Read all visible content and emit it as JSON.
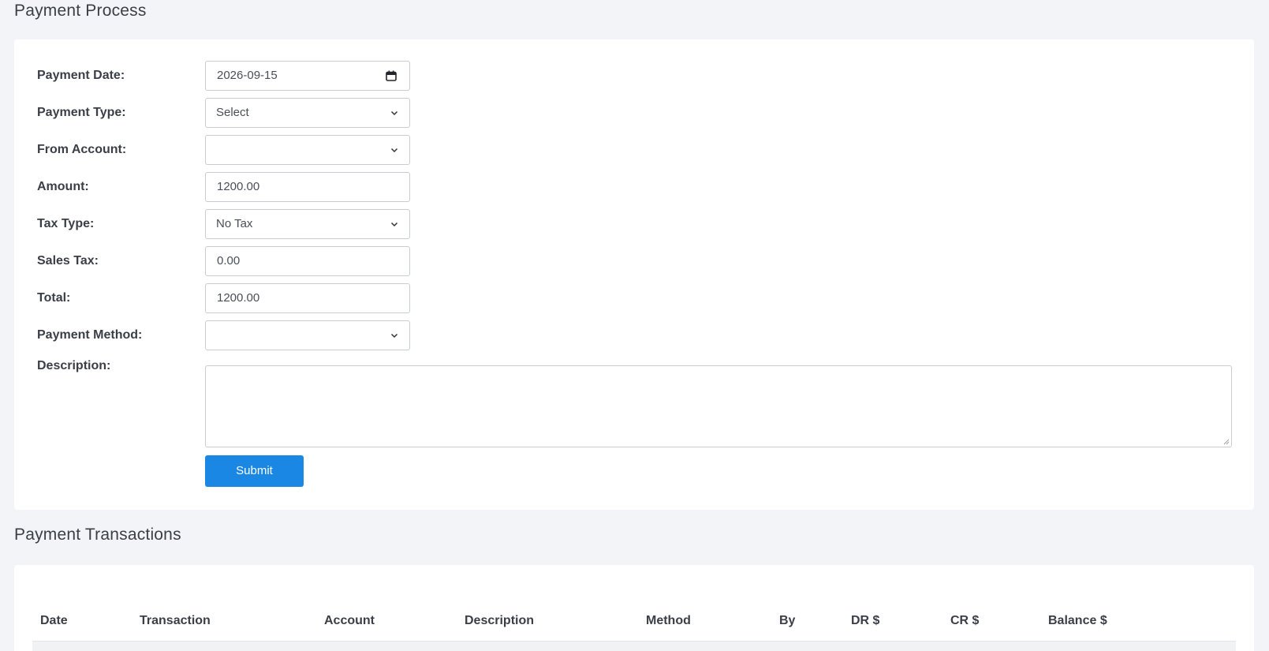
{
  "process": {
    "title": "Payment Process",
    "fields": {
      "payment_date": {
        "label": "Payment Date:",
        "value": "2026-09-15"
      },
      "payment_type": {
        "label": "Payment Type:",
        "value": "Select"
      },
      "from_account": {
        "label": "From Account:",
        "value": ""
      },
      "amount": {
        "label": "Amount:",
        "value": "1200.00"
      },
      "tax_type": {
        "label": "Tax Type:",
        "value": "No Tax"
      },
      "sales_tax": {
        "label": "Sales Tax:",
        "value": "0.00"
      },
      "total": {
        "label": "Total:",
        "value": "1200.00"
      },
      "payment_method": {
        "label": "Payment Method:",
        "value": ""
      },
      "description": {
        "label": "Description:",
        "value": ""
      }
    },
    "submit_label": "Submit",
    "accent_color": "#1b87e5"
  },
  "transactions": {
    "title": "Payment Transactions",
    "columns": [
      "Date",
      "Transaction",
      "Account",
      "Description",
      "Method",
      "By",
      "DR $",
      "CR $",
      "Balance $"
    ]
  },
  "icons": {
    "date_picker": "calendar-icon",
    "select": "chevron-down-icon"
  }
}
